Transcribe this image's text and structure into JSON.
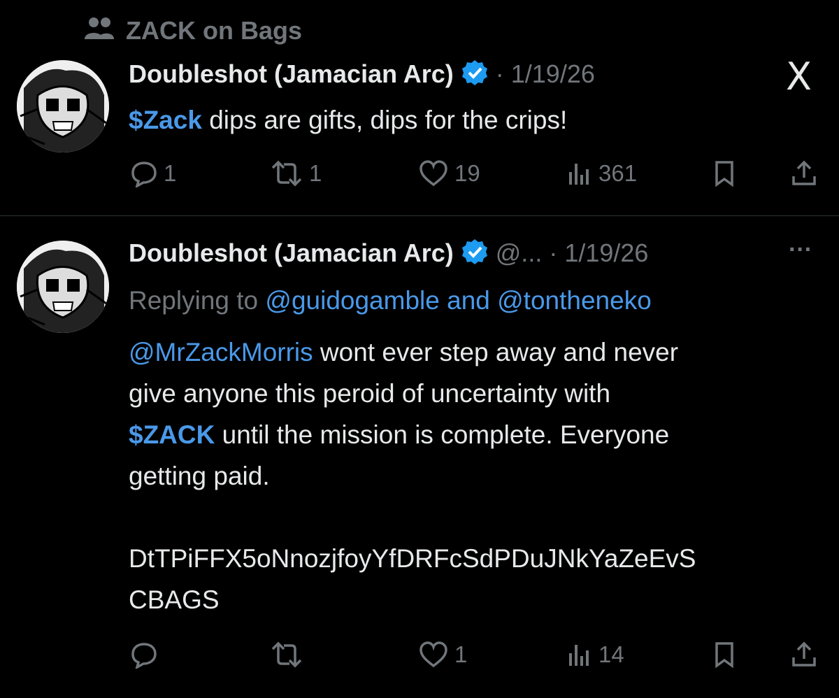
{
  "community": {
    "label": "ZACK on Bags",
    "icon": "community-icon"
  },
  "post1": {
    "author_name": "Doubleshot (Jamacian Arc)",
    "dot_date": "· 1/19/26",
    "text_cashtag": "$Zack",
    "text_rest": " dips are gifts, dips for the crips!",
    "replies": "1",
    "reposts": "1",
    "likes": "19",
    "views": "361",
    "close_glyph": "X"
  },
  "post2": {
    "author_name": "Doubleshot (Jamacian Arc)",
    "handle": "@...",
    "dot_date": "· 1/19/26",
    "more_glyph": "···",
    "replying_prefix": "Replying to ",
    "replying_users": "@guidogamble and @tontheneko",
    "mention": "@MrZackMorris",
    "line1_rest": " wont ever step away and never",
    "line2": "give anyone this peroid of uncertainty with",
    "cashtag": "$ZACK",
    "line3_rest": " until the mission is complete. Everyone",
    "line4": "getting paid.",
    "address_line1": "DtTPiFFX5oNnozjfoyYfDRFcSdPDuJNkYaZeEvS",
    "address_line2": "CBAGS",
    "replies": "",
    "reposts": "",
    "likes": "1",
    "views": "14"
  },
  "colors": {
    "background": "#000000",
    "link": "#4a99e9",
    "muted": "#71767b",
    "text": "#e7e9ea",
    "verified": "#1d9bf0"
  }
}
